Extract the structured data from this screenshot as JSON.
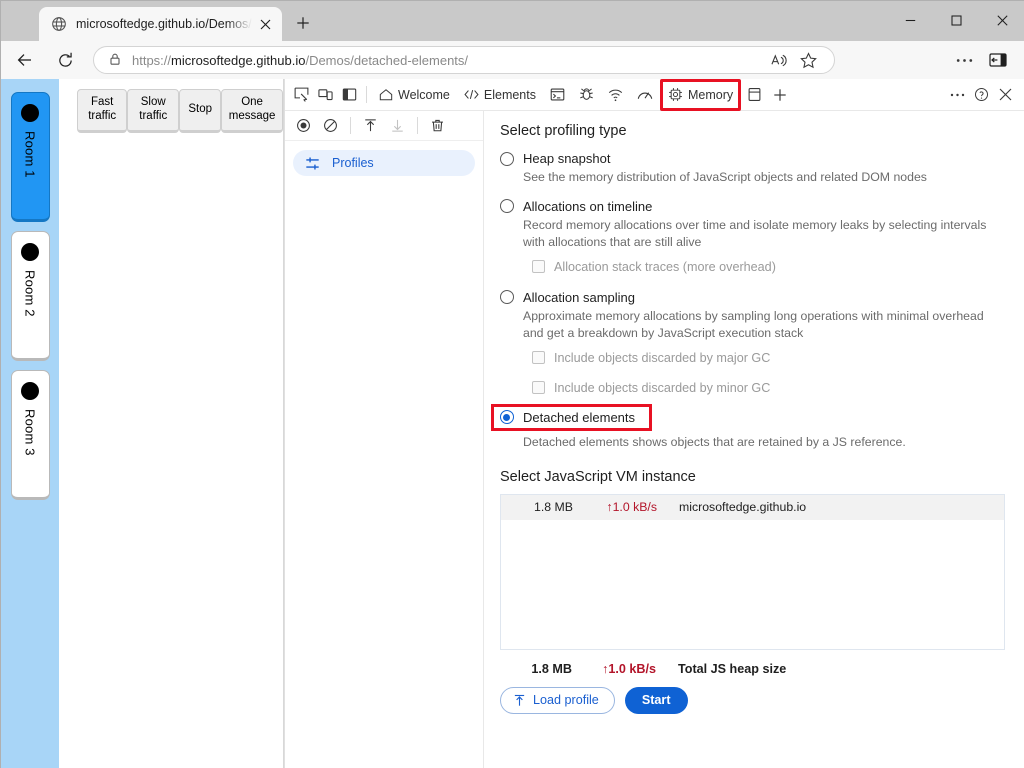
{
  "browser": {
    "tab": {
      "title": "microsoftedge.github.io/Demos/d",
      "favicon_icon": "globe-icon",
      "close_icon": "close-icon"
    },
    "new_tab_icon": "plus-icon",
    "window_controls": {
      "minimize_icon": "minimize-icon",
      "maximize_icon": "maximize-icon",
      "close_icon": "close-icon"
    },
    "nav": {
      "back_icon": "back-arrow-icon",
      "refresh_icon": "refresh-icon",
      "lock_icon": "lock-icon",
      "url_scheme": "https://",
      "url_host": "microsoftedge.github.io",
      "url_path": "/Demos/detached-elements/",
      "read_aloud_icon": "read-aloud-icon",
      "favorite_icon": "star-icon",
      "settings_icon": "ellipsis-icon",
      "sidebar_icon": "sidebar-toggle-icon"
    }
  },
  "page": {
    "rooms": [
      {
        "label": "Room 1",
        "active": true
      },
      {
        "label": "Room 2",
        "active": false
      },
      {
        "label": "Room 3",
        "active": false
      }
    ],
    "traffic_buttons": [
      "Fast traffic",
      "Slow traffic",
      "Stop",
      "One message"
    ]
  },
  "devtools": {
    "toolbar_icons": [
      "inspect-icon",
      "device-emulation-icon",
      "dock-side-icon"
    ],
    "tabs": [
      {
        "label": "Welcome",
        "icon": "home-icon",
        "highlighted": false
      },
      {
        "label": "Elements",
        "icon": "code-brackets-icon",
        "highlighted": false
      },
      {
        "label": "",
        "icon": "console-icon",
        "highlighted": false
      },
      {
        "label": "",
        "icon": "bug-icon",
        "highlighted": false
      },
      {
        "label": "",
        "icon": "network-icon",
        "highlighted": false
      },
      {
        "label": "",
        "icon": "performance-gauge-icon",
        "highlighted": false
      },
      {
        "label": "Memory",
        "icon": "memory-chip-icon",
        "highlighted": true
      },
      {
        "label": "",
        "icon": "application-storage-icon",
        "highlighted": false
      },
      {
        "label": "",
        "icon": "plus-icon",
        "highlighted": false
      }
    ],
    "tabbar_right_icons": [
      "ellipsis-icon",
      "help-icon",
      "close-icon"
    ],
    "sidebar": {
      "tools": [
        "record-icon",
        "clear-icon",
        "load-profile-icon",
        "save-profile-icon",
        "trash-icon"
      ],
      "profiles_label": "Profiles",
      "profiles_icon": "filters-icon"
    },
    "main": {
      "profiling_title": "Select profiling type",
      "options": [
        {
          "label": "Heap snapshot",
          "description": "See the memory distribution of JavaScript objects and related DOM nodes",
          "checked": false
        },
        {
          "label": "Allocations on timeline",
          "description": "Record memory allocations over time and isolate memory leaks by selecting intervals with allocations that are still alive",
          "checked": false,
          "sub_checkboxes": [
            {
              "label": "Allocation stack traces (more overhead)",
              "checked": false,
              "disabled": true
            }
          ]
        },
        {
          "label": "Allocation sampling",
          "description": "Approximate memory allocations by sampling long operations with minimal overhead and get a breakdown by JavaScript execution stack",
          "checked": false,
          "sub_checkboxes": [
            {
              "label": "Include objects discarded by major GC",
              "checked": false,
              "disabled": true
            },
            {
              "label": "Include objects discarded by minor GC",
              "checked": false,
              "disabled": true
            }
          ]
        },
        {
          "label": "Detached elements",
          "description": "Detached elements shows objects that are retained by a JS reference.",
          "checked": true,
          "highlighted": true
        }
      ],
      "vm_title": "Select JavaScript VM instance",
      "vm_rows": [
        {
          "size": "1.8 MB",
          "rate": "1.0 kB/s",
          "host": "microsoftedge.github.io"
        }
      ],
      "total": {
        "size": "1.8 MB",
        "rate": "1.0 kB/s",
        "label": "Total JS heap size"
      },
      "load_profile_label": "Load profile",
      "load_profile_icon": "upload-arrow-icon",
      "start_label": "Start"
    }
  },
  "colors": {
    "accent_blue": "#0f62d4",
    "highlight_red": "#e81123",
    "rail_blue": "#a8d5f7",
    "room_active": "#2196f3",
    "rate_red": "#b3152a"
  }
}
